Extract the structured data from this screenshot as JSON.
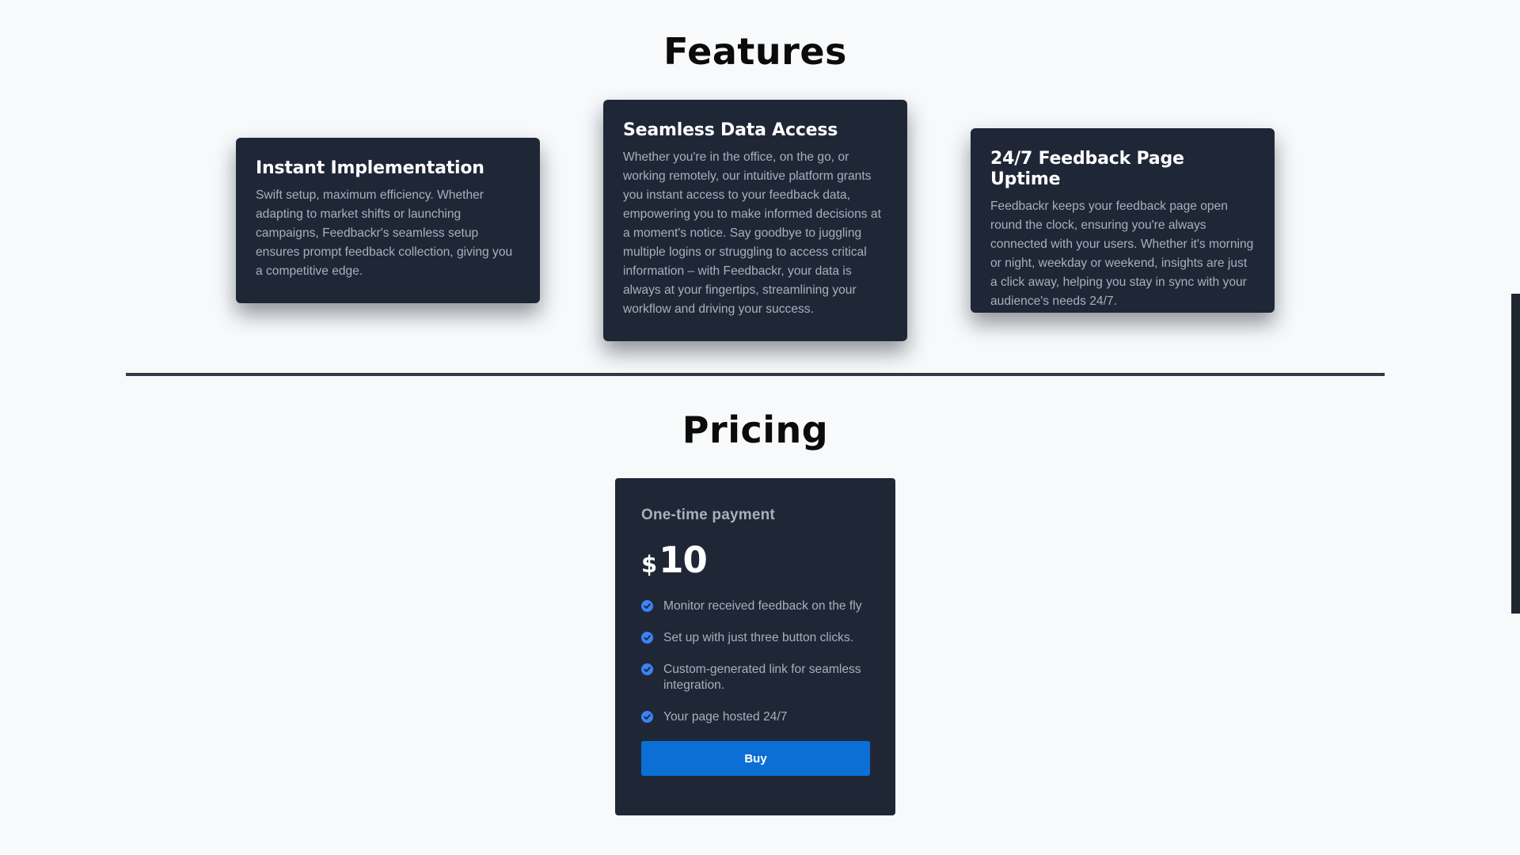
{
  "features": {
    "title": "Features",
    "cards": [
      {
        "title": "Instant Implementation",
        "text": "Swift setup, maximum efficiency. Whether adapting to market shifts or launching campaigns, Feedbackr's seamless setup ensures prompt feedback collection, giving you a competitive edge."
      },
      {
        "title": "Seamless Data Access",
        "text": "Whether you're in the office, on the go, or working remotely, our intuitive platform grants you instant access to your feedback data, empowering you to make informed decisions at a moment's notice. Say goodbye to juggling multiple logins or struggling to access critical information – with Feedbackr, your data is always at your fingertips, streamlining your workflow and driving your success."
      },
      {
        "title": "24/7 Feedback Page Uptime",
        "text": "Feedbackr keeps your feedback page open round the clock, ensuring you're always connected with your users. Whether it's morning or night, weekday or weekend, insights are just a click away, helping you stay in sync with your audience's needs 24/7."
      }
    ]
  },
  "pricing": {
    "title": "Pricing",
    "plan": {
      "name": "One-time payment",
      "currency": "$",
      "amount": "10",
      "features": [
        "Monitor received feedback on the fly",
        "Set up with just three button clicks.",
        "Custom-generated link for seamless integration.",
        "Your page hosted 24/7"
      ],
      "button_label": "Buy"
    }
  },
  "colors": {
    "background": "#f7f9fb",
    "card": "#1f2737",
    "accent": "#0b6fd6",
    "check": "#3b82f6"
  },
  "icons": {
    "feature_check": "check-circle-icon"
  }
}
